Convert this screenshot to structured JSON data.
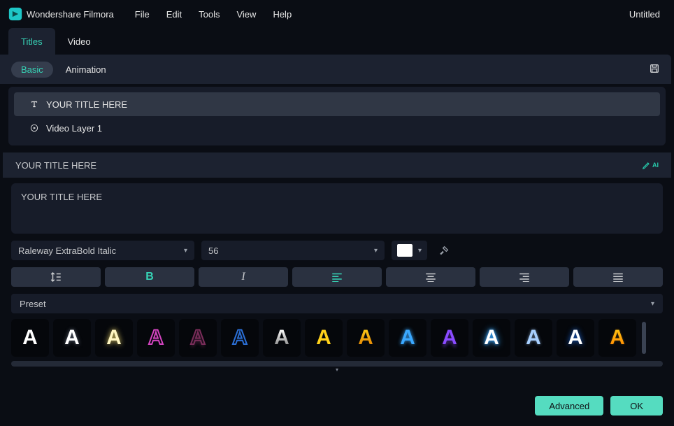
{
  "app": {
    "name": "Wondershare Filmora",
    "project": "Untitled"
  },
  "menu": {
    "items": [
      "File",
      "Edit",
      "Tools",
      "View",
      "Help"
    ]
  },
  "topTabs": {
    "active": "Titles",
    "other": "Video"
  },
  "subTabs": {
    "active": "Basic",
    "other": "Animation"
  },
  "layers": {
    "title": {
      "label": "YOUR TITLE HERE",
      "selected": true
    },
    "video": {
      "label": "Video Layer 1",
      "selected": false
    }
  },
  "section": {
    "header": "YOUR TITLE HERE"
  },
  "textbox": {
    "value": "YOUR TITLE HERE"
  },
  "font": {
    "family": "Raleway ExtraBold Italic",
    "size": "56",
    "colorHex": "#FFFFFF"
  },
  "tools": {
    "lineSpacing": "line-spacing",
    "bold": "B",
    "italic": "I"
  },
  "preset": {
    "label": "Preset",
    "glyph": "A"
  },
  "footer": {
    "advanced": "Advanced",
    "ok": "OK"
  }
}
